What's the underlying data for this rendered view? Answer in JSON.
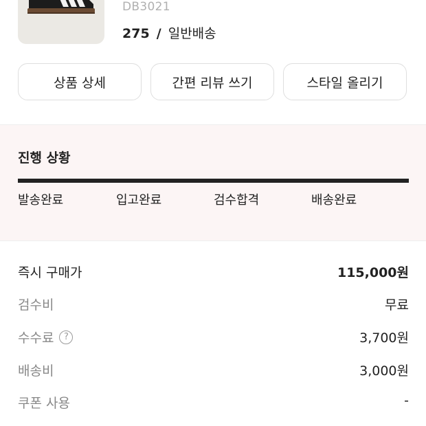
{
  "product": {
    "model_number": "DB3021",
    "size": "275",
    "separator": "/",
    "shipping_type": "일반배송"
  },
  "actions": {
    "detail": "상품 상세",
    "quick_review": "간편 리뷰 쓰기",
    "post_style": "스타일 올리기"
  },
  "progress": {
    "title": "진행 상황",
    "steps": [
      "발송완료",
      "입고완료",
      "검수합격",
      "배송완료"
    ]
  },
  "summary": {
    "buy_now": {
      "label": "즉시 구매가",
      "value": "115,000원"
    },
    "inspection": {
      "label": "검수비",
      "value": "무료"
    },
    "fee": {
      "label": "수수료",
      "value": "3,700원",
      "help_icon": "?"
    },
    "shipping": {
      "label": "배송비",
      "value": "3,000원"
    },
    "coupon": {
      "label": "쿠폰 사용",
      "value": "-"
    }
  }
}
